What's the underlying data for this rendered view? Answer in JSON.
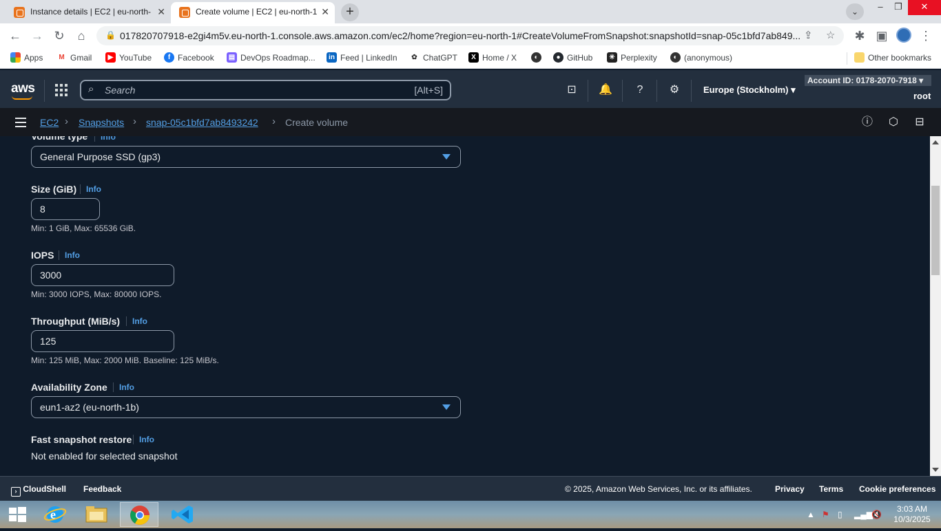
{
  "browser": {
    "tabs": [
      {
        "title": "Instance details | EC2 | eu-north-"
      },
      {
        "title": "Create volume | EC2 | eu-north-1"
      }
    ],
    "url": "017820707918-e2gi4m5v.eu-north-1.console.aws.amazon.com/ec2/home?region=eu-north-1#CreateVolumeFromSnapshot:snapshotId=snap-05c1bfd7ab849...",
    "bookmarks": [
      "Apps",
      "Gmail",
      "YouTube",
      "Facebook",
      "DevOps Roadmap...",
      "Feed | LinkedIn",
      "ChatGPT",
      "Home / X",
      "",
      "GitHub",
      "Perplexity",
      "(anonymous)"
    ],
    "other_bookmarks": "Other bookmarks"
  },
  "aws": {
    "logo": "aws",
    "search_placeholder": "Search",
    "search_shortcut": "[Alt+S]",
    "region": "Europe (Stockholm)",
    "account": "Account ID: 0178-2070-7918",
    "user": "root"
  },
  "breadcrumb": {
    "items": [
      "EC2",
      "Snapshots",
      "snap-05c1bfd7ab8493242"
    ],
    "current": "Create volume"
  },
  "form": {
    "info_label": "Info",
    "volume_type": {
      "label": "Volume type",
      "value": "General Purpose SSD (gp3)"
    },
    "size": {
      "label": "Size (GiB)",
      "value": "8",
      "hint": "Min: 1 GiB, Max: 65536 GiB."
    },
    "iops": {
      "label": "IOPS",
      "value": "3000",
      "hint": "Min: 3000 IOPS, Max: 80000 IOPS."
    },
    "throughput": {
      "label": "Throughput (MiB/s)",
      "value": "125",
      "hint": "Min: 125 MiB, Max: 2000 MiB. Baseline: 125 MiB/s."
    },
    "availability_zone": {
      "label": "Availability Zone",
      "value": "eun1-az2 (eu-north-1b)"
    },
    "fast_snapshot_restore": {
      "label": "Fast snapshot restore",
      "value": "Not enabled for selected snapshot"
    }
  },
  "footer": {
    "cloudshell": "CloudShell",
    "feedback": "Feedback",
    "copyright": "© 2025, Amazon Web Services, Inc. or its affiliates.",
    "privacy": "Privacy",
    "terms": "Terms",
    "cookies": "Cookie preferences"
  },
  "taskbar": {
    "time": "3:03 AM",
    "date": "10/3/2025"
  },
  "colors": {
    "aws_header": "#232f3e",
    "link": "#539fe5",
    "body_bg": "#0f1b2a",
    "aws_orange": "#ff9900"
  }
}
